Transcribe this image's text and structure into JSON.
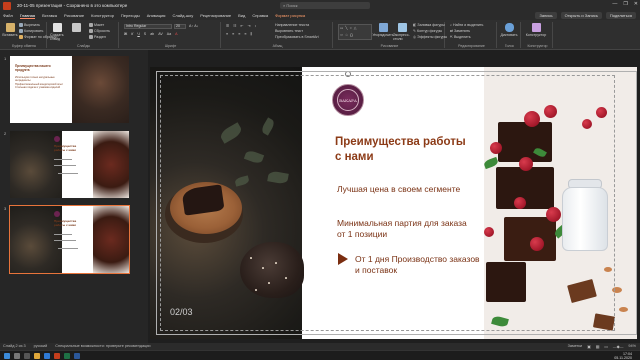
{
  "window": {
    "title": "20-11-05 презентация - Сохранено в это компьютере",
    "search_placeholder": "Поиск",
    "controls": [
      "—",
      "❐",
      "✕"
    ]
  },
  "ribbon_tabs": [
    "Файл",
    "Главная",
    "Вставка",
    "Рисование",
    "Конструктор",
    "Переходы",
    "Анимация",
    "Слайд-шоу",
    "Рецензирование",
    "Вид",
    "Справка",
    "Формат рисунка"
  ],
  "active_tab": "Главная",
  "top_right": {
    "share": "Запись",
    "present": "Открыть и Запись",
    "share2": "Поделиться"
  },
  "ribbon": {
    "clipboard": {
      "label": "Буфер обмена",
      "paste": "Вставить",
      "cut": "Вырезать",
      "copy": "Копировать",
      "format": "Формат по образцу"
    },
    "slides": {
      "label": "Слайды",
      "new_slide": "Создать слайд",
      "reuse": "Повторное использование слайдов",
      "layout": "Макет",
      "reset": "Сбросить",
      "section": "Раздел"
    },
    "font": {
      "label": "Шрифт",
      "font_name": "Intro Regular",
      "font_size": "20"
    },
    "paragraph": {
      "label": "Абзац",
      "direction": "Направление текста",
      "align": "Выровнять текст",
      "smartart": "Преобразовать в SmartArt"
    },
    "drawing": {
      "label": "Рисование",
      "arrange": "Упорядочить",
      "quick_styles": "Экспресс-стили",
      "fill": "Заливка фигуры",
      "outline": "Контур фигуры",
      "effects": "Эффекты фигуры"
    },
    "editing": {
      "label": "Редактирование",
      "find": "Найти и выделить",
      "replace": "Заменить",
      "select": "Выделить"
    },
    "voice": {
      "label": "Голос",
      "dictate": "Диктовать"
    },
    "designer": {
      "label": "Конструктор",
      "ideas": "Конструктор"
    }
  },
  "thumbnails": [
    {
      "num": "1",
      "title": "Преимущества нашего продукта",
      "items": [
        "Используем только натуральные ингредиенты",
        "Профессиональный кондитерский опыт",
        "Стильная подача и упаковка изделий"
      ]
    },
    {
      "num": "2",
      "title": "Преимущества работы с нами"
    },
    {
      "num": "3",
      "title": "Преимущества работы с нами"
    }
  ],
  "slide": {
    "heading": "Преимущества работы с нами",
    "point1": "Лучшая цена в своем сегменте",
    "point2": "Минимальная партия для заказа от 1 позиции",
    "point3": "От 1 дня Производство заказов и поставок",
    "page_number": "02/03",
    "logo_text": "ВАКАРА"
  },
  "status": {
    "slide_info": "Слайд 2 из 3",
    "language": "русский",
    "accessibility": "Специальные возможности: проверьте рекомендации",
    "notes": "Заметки",
    "zoom": "94%",
    "time": "17:04",
    "date": "05.11.2020"
  },
  "colors": {
    "accent": "#8c3b17",
    "brand": "#c43e1c",
    "logo": "#6b2350"
  }
}
